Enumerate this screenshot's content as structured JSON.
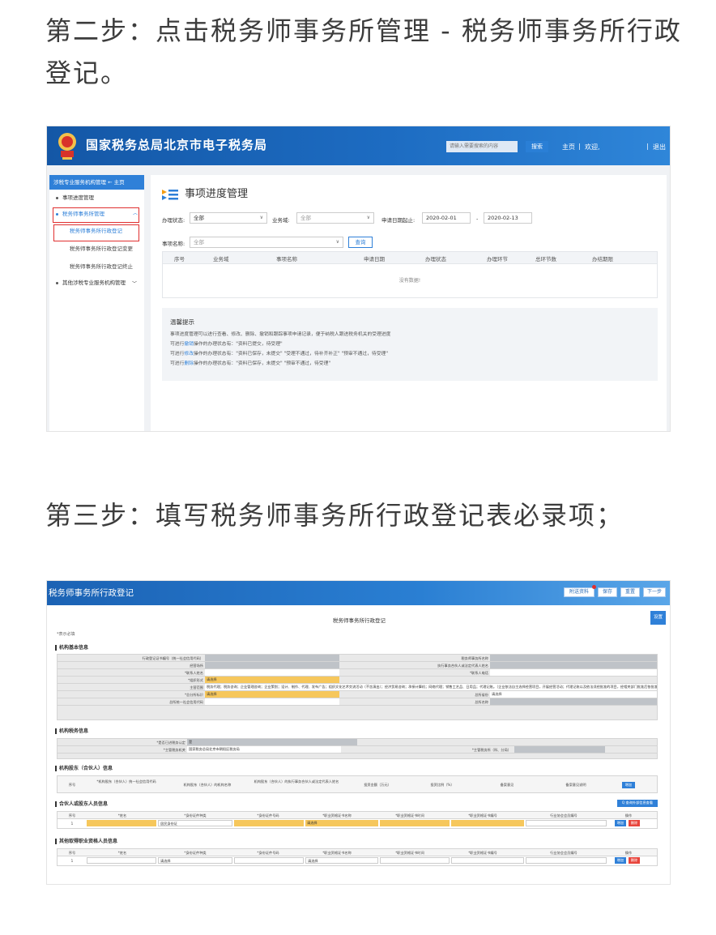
{
  "step2_text": "第二步：点击税务师事务所管理 - 税务师事务所行政登记。",
  "step3_text": "第三步：填写税务师事务所行政登记表必录项；",
  "shot1": {
    "site_title": "国家税务总局北京市电子税务局",
    "search_placeholder": "请输入需要搜索的内容",
    "search_btn": "搜索",
    "nav_home": "主页",
    "nav_sep1": "|",
    "nav_welcome": "欢迎,",
    "nav_sep2": "|",
    "nav_logout": "退出",
    "sidebar": {
      "head": "涉税专业服务机构管理 ← 主页",
      "item_progress": "事项进度管理",
      "item_firm_mgmt": "税务师事务所管理",
      "sub_admin_reg": "税务师事务所行政登记",
      "sub_admin_change": "税务师事务所行政登记变更",
      "sub_admin_end": "税务师事务所行政登记终止",
      "item_other": "其他涉税专业服务机构管理"
    },
    "main": {
      "title": "事项进度管理",
      "label_status": "办理状态:",
      "status_value": "全部",
      "label_domain": "业务域:",
      "domain_value": "全部",
      "label_date": "申请日期起止:",
      "date_from": "2020-02-01",
      "date_sep": "-",
      "date_to": "2020-02-13",
      "label_item": "事项名称:",
      "item_value": "全部",
      "query_btn": "查询",
      "columns": [
        "序号",
        "业务域",
        "事项名称",
        "申请日期",
        "办理状态",
        "办理环节",
        "总环节数",
        "办结期限"
      ],
      "empty_text": "没有数据!",
      "tips_title": "温馨提示",
      "tips": [
        {
          "pre": "事项进度管理可以进行查看、修改、删除、撤销和跟踪事项申请记录，便于纳税人跟进税务机关的受理进度",
          "hl": "",
          "post": ""
        },
        {
          "pre": "可进行",
          "hl": "撤销",
          "post": "操作的办理状态有：\"资料已提交，待受理\""
        },
        {
          "pre": "可进行",
          "hl": "修改",
          "post": "操作的办理状态有：\"资料已保存，未提交\"  \"受理不通过，待补齐补正\"  \"预审不通过，待受理\""
        },
        {
          "pre": "可进行",
          "hl": "删除",
          "post": "操作的办理状态有：\"资料已保存，未提交\"  \"预审不通过，待受理\""
        }
      ]
    }
  },
  "shot2": {
    "title": "税务师事务所行政登记",
    "btn_attach": "附送资料",
    "btn_save": "保存",
    "btn_reset": "重置",
    "btn_next": "下一步",
    "form_title": "税务师事务所行政登记",
    "side_btn": "设置",
    "required_note": "*表示必填",
    "sec_basic": "机构基本信息",
    "basic": {
      "l_cert": "行政登记证书编号（统一社会信用代码）",
      "l_firm_name": "税务师事务所名称",
      "l_place": "经营场所",
      "l_partner": "执行事务合伙人或法定代表人姓名",
      "l_contact": "*联系人姓名",
      "l_phone": "*联系人电话",
      "l_org_form": "*组织形式",
      "v_org_form": "请选择",
      "l_scope": "主营范围",
      "v_scope": "税务代理；税务咨询；企业管理咨询；企业策划；设计、制作、代理、发布广告；组织文化艺术交流活动（不含演出）；经济贸易咨询；承接计算机；网络代理；销售工艺品、日用品；代理记账。（企业依法自主选择经营项目，开展经营活动；代理记账以及依法须经批准的项目，经相关部门批准后依批准的内容开展经营活动）",
      "l_branch_flag": "*总分所标识",
      "v_branch_flag": "请选择",
      "l_head_province": "总所省份",
      "v_head_province": "请选择",
      "l_head_code": "总所统一社会信用代码",
      "l_head_name": "总所名称"
    },
    "sec_tax": "机构税务信息",
    "tax": {
      "l_agent": "*是否已进税务认定",
      "v_agent": "是",
      "l_authority": "*主管税务机关",
      "v_authority": "国家税务总局北京市朝阳区税务局",
      "l_office": "*主管税务所（科、分局）"
    },
    "sec_shareholder": "机构股东（合伙人）信息",
    "shareholder_cols": [
      "序号",
      "*机构股东（合伙人）统一社会信用代码",
      "机构股东（合伙人）的机构名称",
      "机构股东（合伙人）的执行事务合伙人或法定代表人姓名",
      "投资金额（万元）",
      "投资比例（%）",
      "备案意见",
      "备案意见说明"
    ],
    "shareholder_add": "增加",
    "sec_partner": "合伙人或股东人员信息",
    "partner_query_btn": "Q 查询外部信息查看",
    "partner_cols": [
      "序号",
      "*姓名",
      "*身份证件种类",
      "*身份证件号码",
      "*职业资格证书名称",
      "*职业资格证书时间",
      "*职业资格证书编号",
      "行业协会会员编号",
      "操作"
    ],
    "partner_row": {
      "no": "1",
      "id_type": "居民身份证",
      "cert_name": "请选择"
    },
    "partner_add": "增加",
    "partner_del": "删除",
    "sec_other": "其他取得职业资格人员信息",
    "other_cols": [
      "序号",
      "*姓名",
      "*身份证件种类",
      "*身份证件号码",
      "*职业资格证书名称",
      "*职业资格证书时间",
      "*职业资格证书编号",
      "行业协会会员编号",
      "操作"
    ],
    "other_row": {
      "no": "1",
      "id_type": "请选择",
      "cert_name": "请选择"
    },
    "other_add": "增加",
    "other_del": "删除"
  },
  "colors": {
    "header_blue": "#1d6cc2",
    "accent_blue": "#2f80d8",
    "highlight_red": "#e03030",
    "required_yellow": "#f6c75c"
  }
}
